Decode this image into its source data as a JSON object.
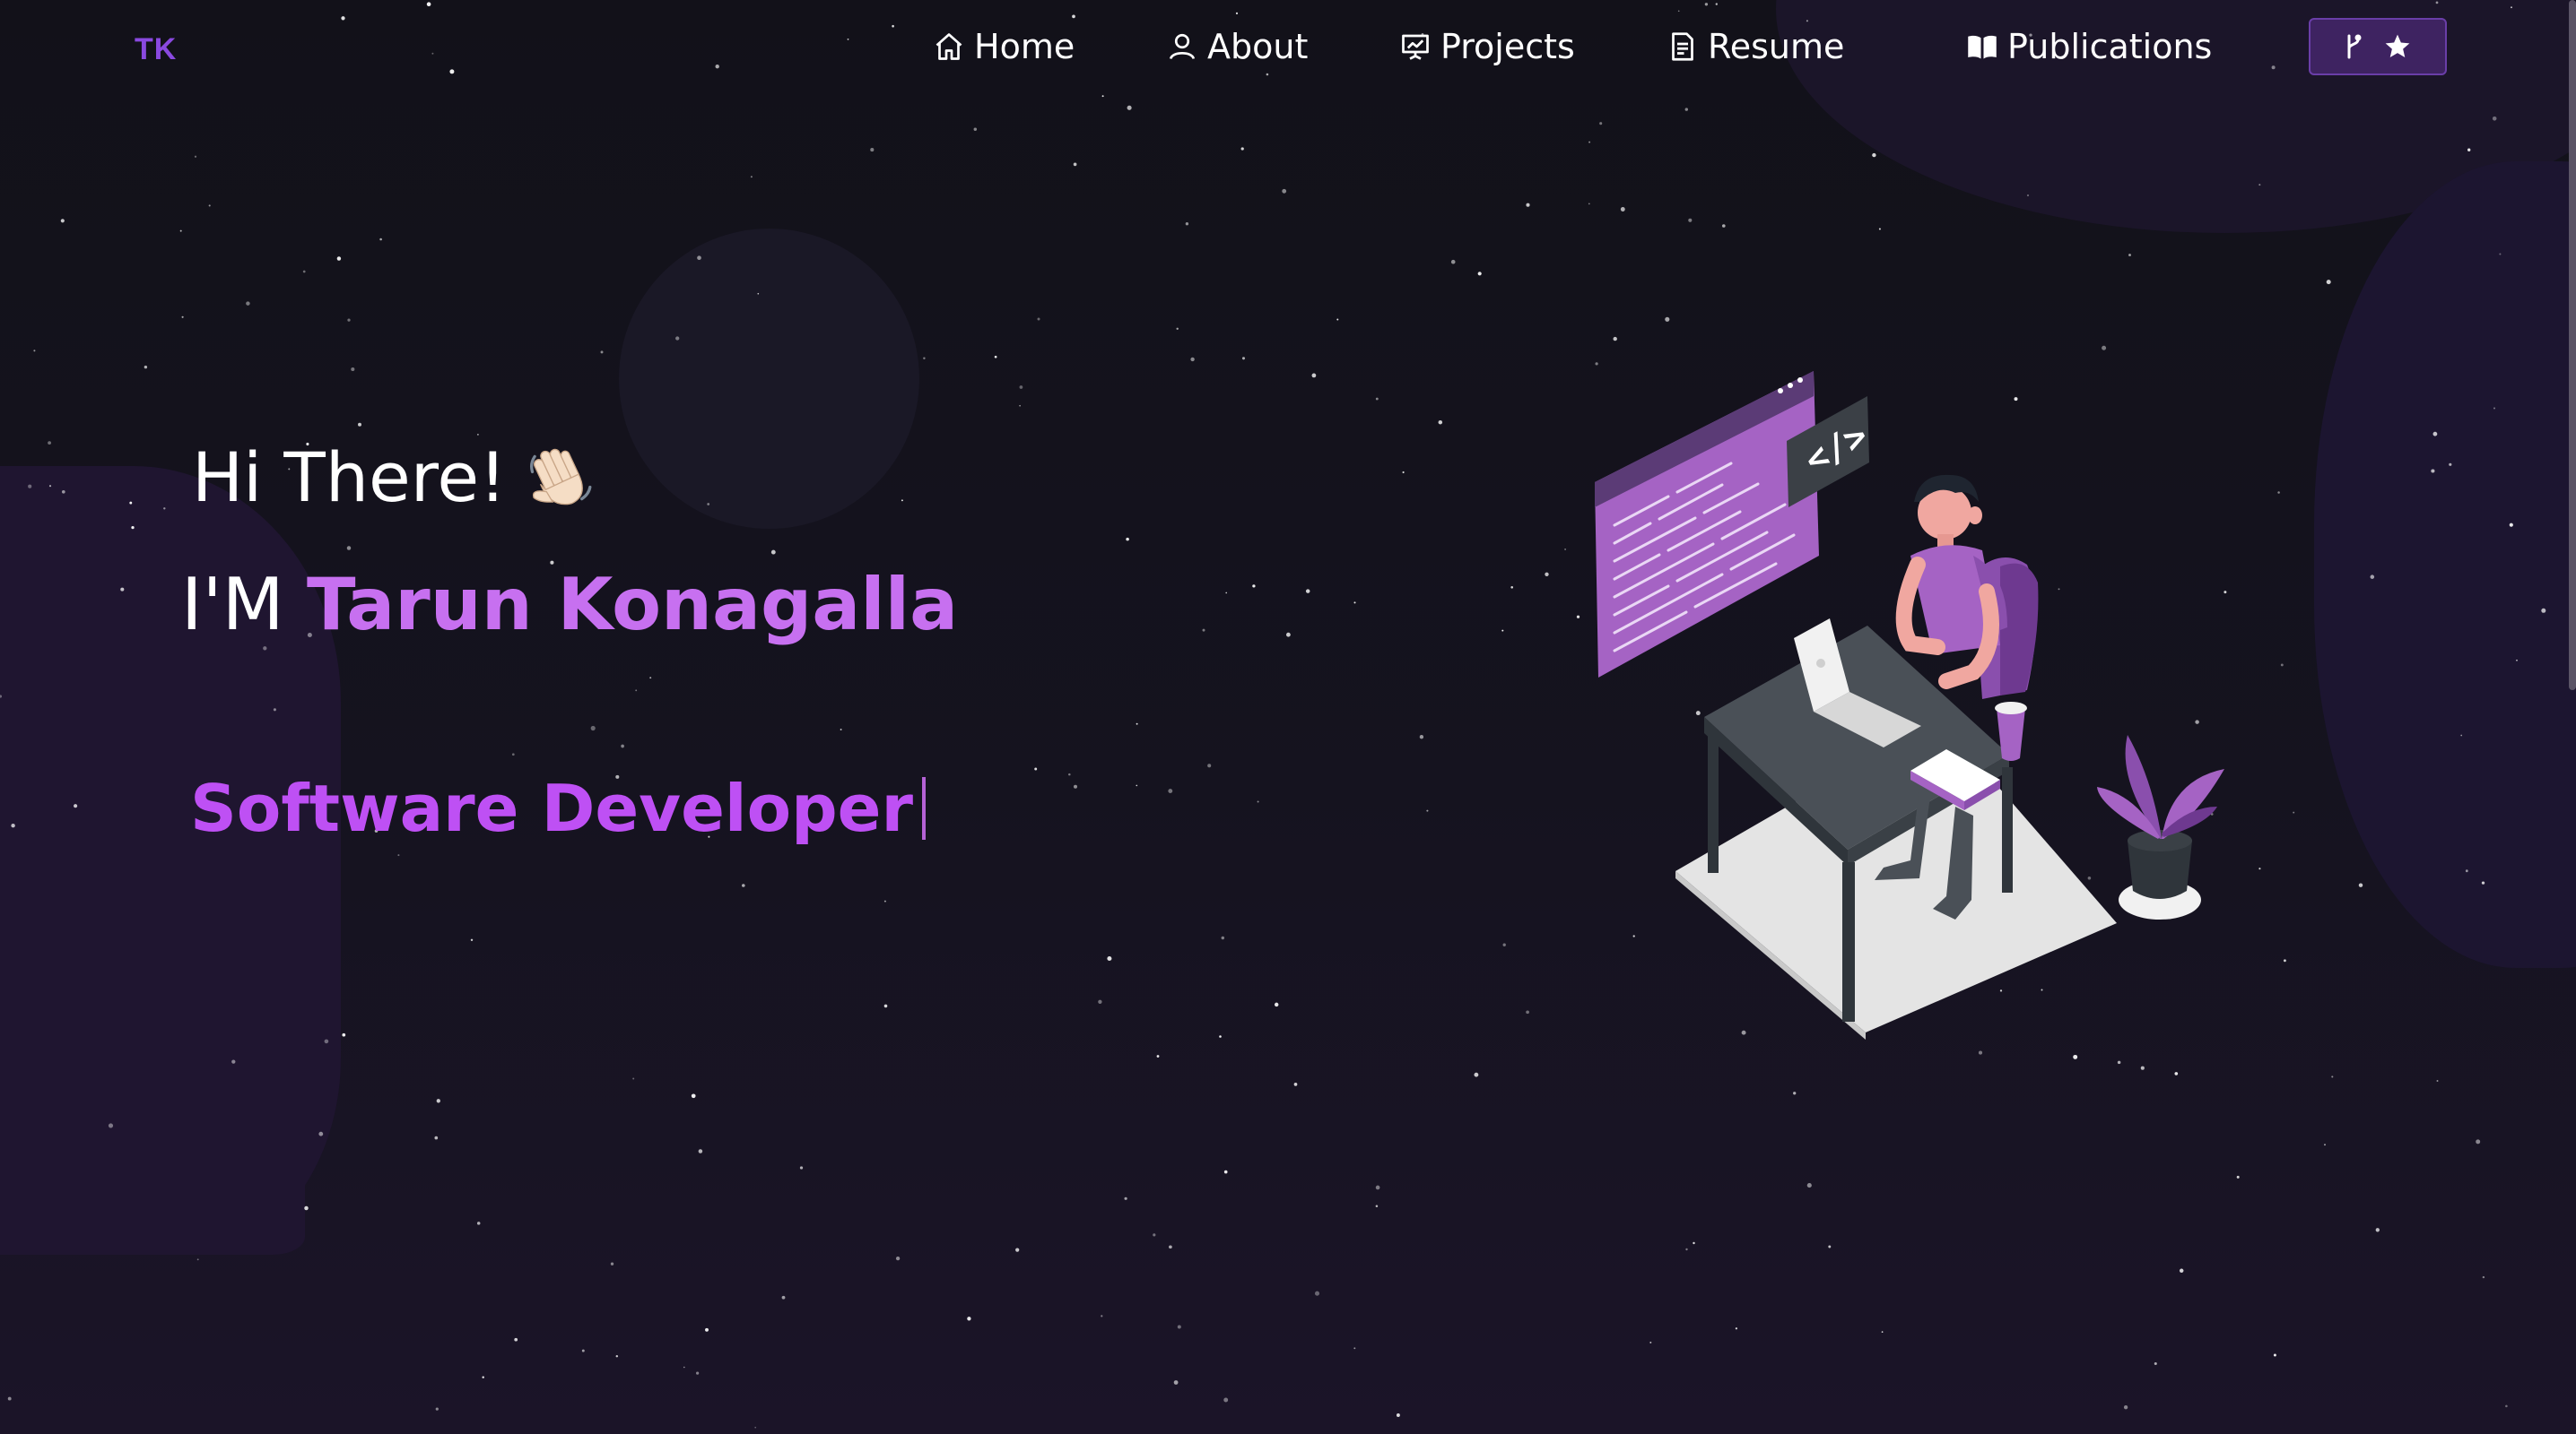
{
  "brand": {
    "logo_text": "TK",
    "accent": "#c770f0"
  },
  "nav": {
    "items": [
      {
        "label": "Home",
        "icon": "home-icon"
      },
      {
        "label": "About",
        "icon": "user-icon"
      },
      {
        "label": "Projects",
        "icon": "presentation-chart-icon"
      },
      {
        "label": "Resume",
        "icon": "document-icon"
      },
      {
        "label": "Publications",
        "icon": "open-book-icon"
      }
    ],
    "repo_button": {
      "icons": [
        "git-fork-icon",
        "star-icon"
      ]
    }
  },
  "hero": {
    "greeting": "Hi There!",
    "greeting_emoji": "waving-hand-icon",
    "intro_prefix": "I'M",
    "name": "Tarun Konagalla",
    "role": "Software Developer"
  },
  "illustration": {
    "icon": "developer-at-desk-illustration"
  },
  "colors": {
    "background": "#14121c",
    "accent_purple": "#c770f0",
    "button_bg": "#3e2361"
  }
}
